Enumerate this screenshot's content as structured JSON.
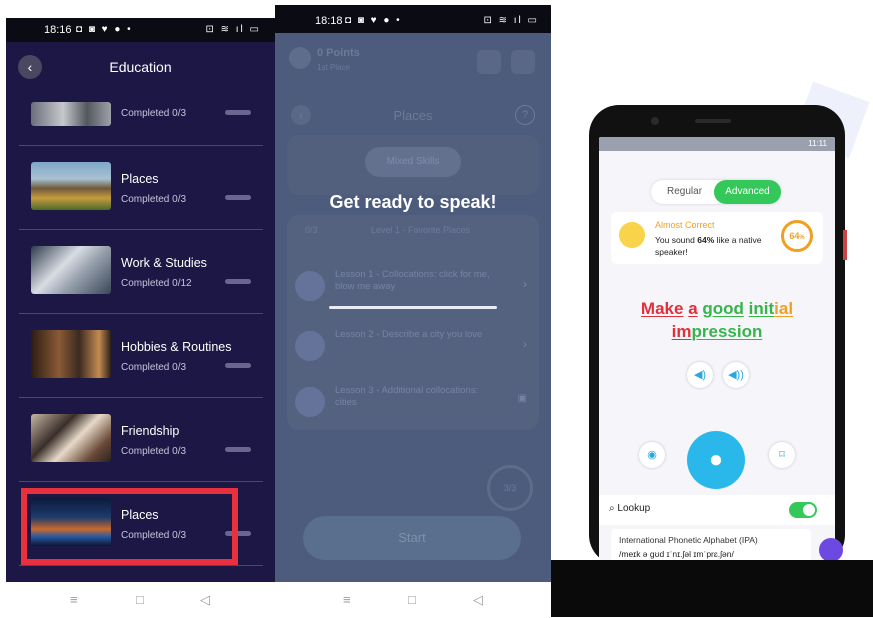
{
  "panel1": {
    "status": {
      "time": "18:16",
      "left_icons": "◘ ◙ ♥ ● •",
      "right_icons": "⊡ ≋ ıl ▭"
    },
    "title": "Education",
    "categories": [
      {
        "name": "",
        "progress": "Completed 0/3"
      },
      {
        "name": "Places",
        "progress": "Completed 0/3"
      },
      {
        "name": "Work & Studies",
        "progress": "Completed 0/12"
      },
      {
        "name": "Hobbies & Routines",
        "progress": "Completed 0/3"
      },
      {
        "name": "Friendship",
        "progress": "Completed 0/3"
      },
      {
        "name": "Places",
        "progress": "Completed 0/3"
      }
    ],
    "nav": {
      "menu": "≡",
      "home": "□",
      "back": "◁"
    }
  },
  "panel2": {
    "status": {
      "time": "18:18",
      "left_icons": "◘ ◙ ♥ ● •",
      "right_icons": "⊡ ≋ ıl ▭"
    },
    "points": "0 Points",
    "points_sub": "1st Place",
    "screen_title": "Places",
    "help": "?",
    "chip": "Mixed Skills",
    "counter": "0/3",
    "level": "Level 1 - Favorite Places",
    "lessons": [
      {
        "label": "Lesson 1 - Collocations: click for me, blow me away"
      },
      {
        "label": "Lesson 2 - Describe a city you love"
      },
      {
        "label": "Lesson 3 - Additional collocations: cities"
      }
    ],
    "overlay_title": "Get ready to speak!",
    "timer": "3/3",
    "start_label": "Start",
    "nav": {
      "menu": "≡",
      "home": "□",
      "back": "◁"
    }
  },
  "panel3": {
    "status_time": "11:11",
    "toggle": {
      "regular": "Regular",
      "advanced": "Advanced"
    },
    "result": {
      "title": "Almost Correct",
      "text_pre": "You sound ",
      "percent_bold": "64%",
      "text_post": " like a native speaker!",
      "score": "64",
      "score_unit": "%"
    },
    "phrase_words": [
      {
        "text": "Make",
        "color": "#e0303c"
      },
      {
        "text": "a",
        "color": "#e0303c"
      },
      {
        "text": "good",
        "color": "#36b54a"
      },
      {
        "text": "init",
        "color": "#36b54a"
      },
      {
        "text": "ial",
        "color": "#f0a020"
      },
      {
        "text": "im",
        "color": "#e0303c"
      },
      {
        "text": "pression",
        "color": "#36b54a"
      }
    ],
    "lookup_label": "Lookup",
    "ipa_label": "International Phonetic Alphabet (IPA)",
    "ipa_text": "/meɪk ə ɡʊd ɪˈnɪ.ʃəl ɪmˈprɛ.ʃən/"
  },
  "colors": {
    "panel1_bg": "#1c1744",
    "highlight": "#e8303e",
    "panel2_bg": "#4d5b7c",
    "accent_green": "#34c759",
    "mic_blue": "#2ab8ea"
  },
  "icons": [
    "back-arrow-icon",
    "speaker-icon",
    "slow-speaker-icon",
    "ear-icon",
    "microphone-icon",
    "bookmark-icon",
    "search-icon"
  ]
}
